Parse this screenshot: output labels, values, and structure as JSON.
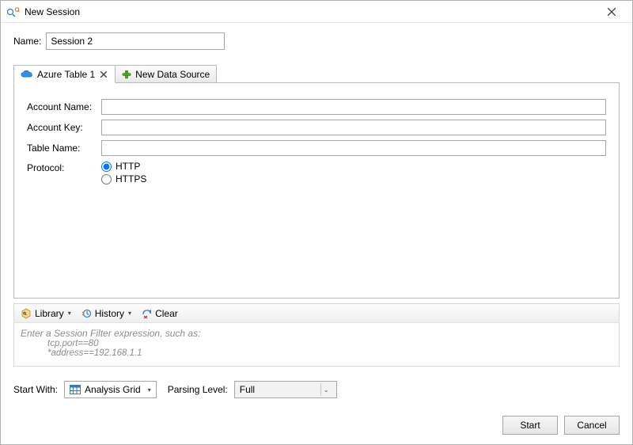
{
  "window": {
    "title": "New Session"
  },
  "name_field": {
    "label": "Name:",
    "value": "Session 2"
  },
  "tabs": {
    "active_label": "Azure Table 1",
    "new_label": "New Data Source"
  },
  "form": {
    "account_name": {
      "label": "Account Name:",
      "value": ""
    },
    "account_key": {
      "label": "Account Key:",
      "value": ""
    },
    "table_name": {
      "label": "Table Name:",
      "value": ""
    },
    "protocol": {
      "label": "Protocol:",
      "options": {
        "http": "HTTP",
        "https": "HTTPS"
      },
      "selected": "http"
    }
  },
  "filter": {
    "library_label": "Library",
    "history_label": "History",
    "clear_label": "Clear",
    "placeholder_line1": "Enter a Session Filter expression, such as:",
    "placeholder_line2": "tcp.port==80",
    "placeholder_line3": "*address==192.168.1.1"
  },
  "start_with": {
    "label": "Start With:",
    "value": "Analysis Grid"
  },
  "parsing_level": {
    "label": "Parsing Level:",
    "value": "Full"
  },
  "buttons": {
    "start": "Start",
    "cancel": "Cancel"
  }
}
